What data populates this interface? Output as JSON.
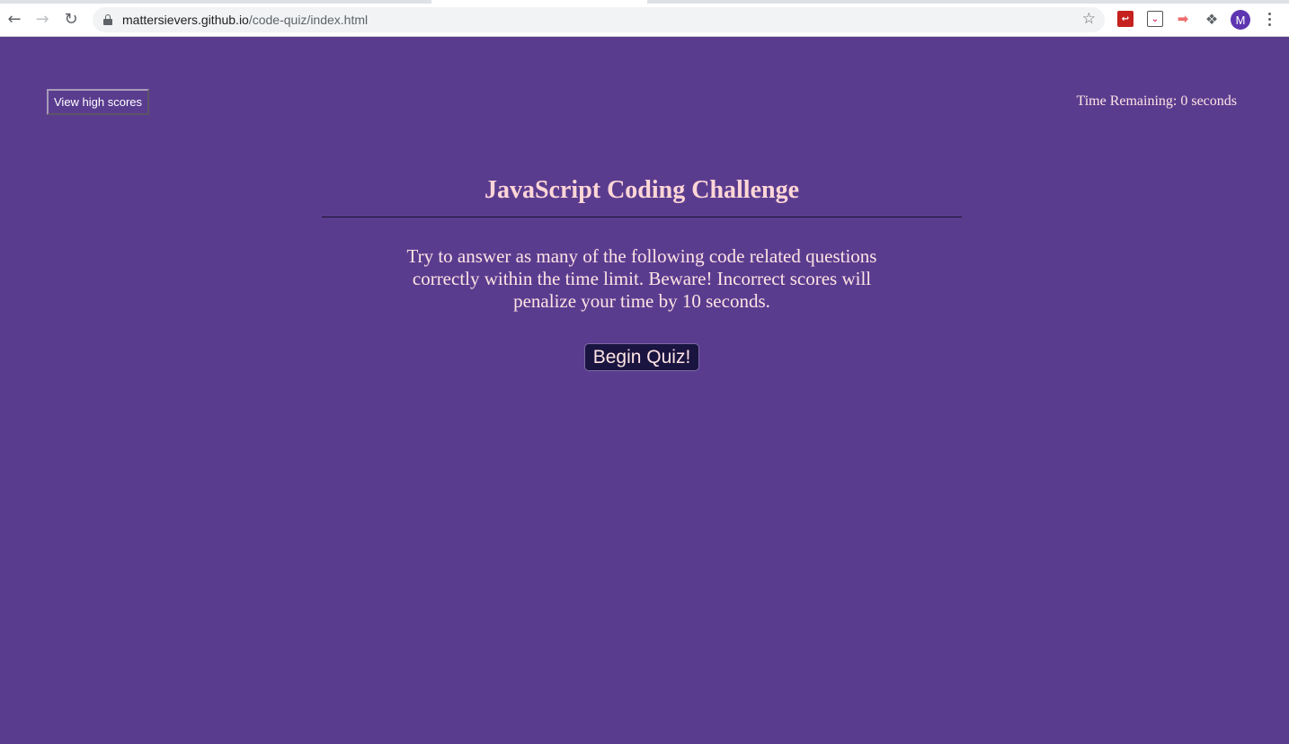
{
  "browser": {
    "url_domain": "mattersievers.github.io",
    "url_path": "/code-quiz/index.html",
    "profile_initial": "M",
    "icons": [
      "back-icon",
      "forward-icon",
      "reload-icon",
      "lock-icon",
      "star-icon",
      "pdf-extension-icon",
      "pocket-extension-icon",
      "tag-extension-icon",
      "puzzle-icon",
      "menu-icon"
    ]
  },
  "header": {
    "high_scores_label": "View high scores",
    "timer_text": "Time Remaining: 0 seconds"
  },
  "main": {
    "title": "JavaScript Coding Challenge",
    "description": "Try to answer as many of the following code related questions correctly within the time limit. Beware! Incorrect scores will penalize your time by 10 seconds.",
    "begin_label": "Begin Quiz!"
  },
  "colors": {
    "background": "#5a3c8f",
    "title": "#ffd6d6",
    "text": "#ffe4e4",
    "button_dark": "#1a1440"
  }
}
